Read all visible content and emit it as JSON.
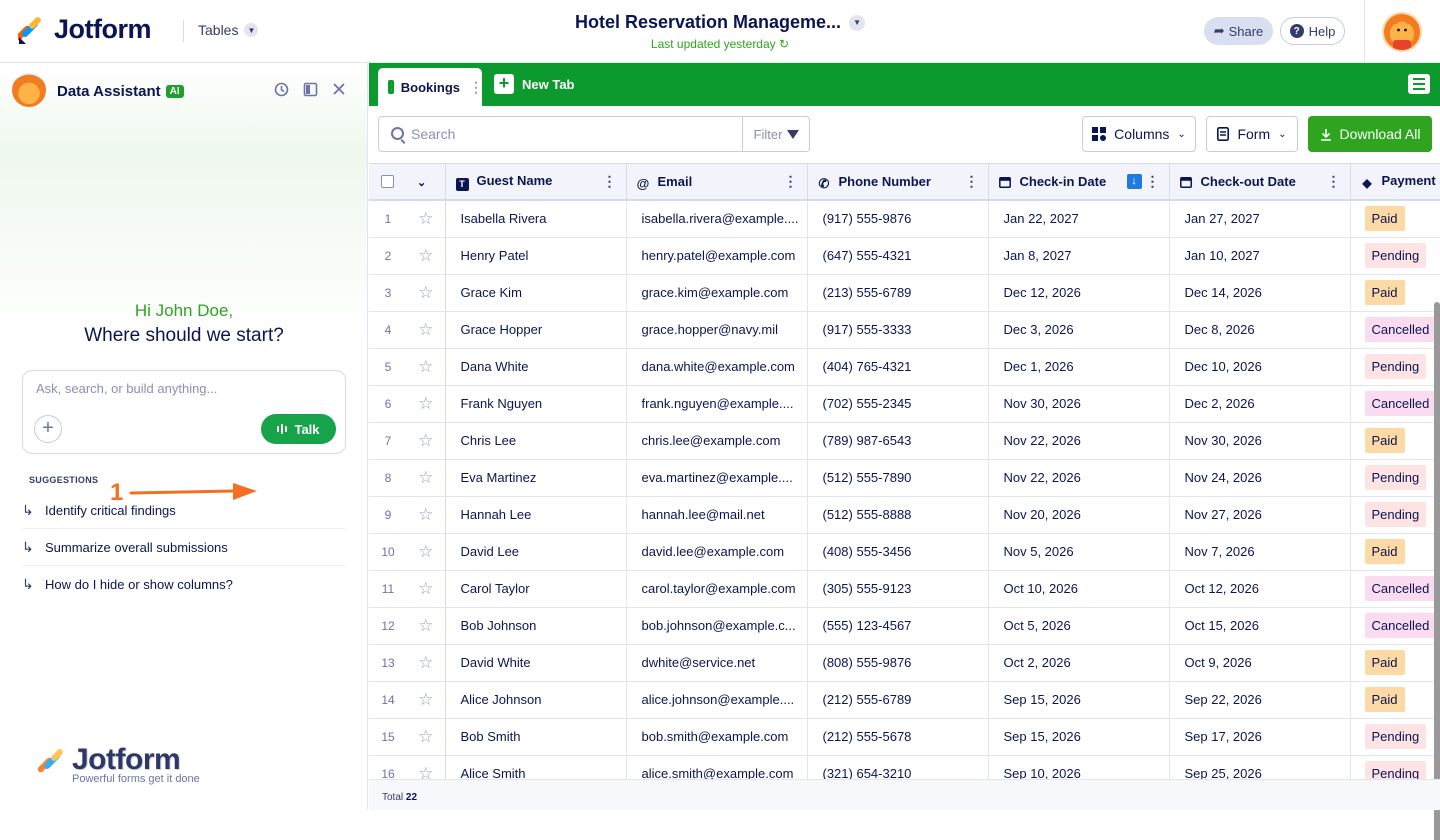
{
  "app": {
    "logo_text": "Jotform",
    "tables_label": "Tables",
    "title": "Hotel Reservation Manageme...",
    "updated": "Last updated yesterday",
    "share_label": "Share",
    "help_label": "Help"
  },
  "assistant": {
    "title": "Data Assistant",
    "ai_badge": "AI",
    "greeting": "Hi John Doe,",
    "prompt": "Where should we start?",
    "input_placeholder": "Ask, search, or build anything...",
    "talk_label": "Talk",
    "step_number": "1",
    "suggestions_title": "SUGGESTIONS",
    "suggestions": [
      "Identify critical findings",
      "Summarize overall submissions",
      "How do I hide or show columns?"
    ],
    "footer_logo": "Jotform",
    "footer_tagline": "Powerful forms get it done"
  },
  "tabs": {
    "active": "Bookings",
    "new_tab": "New Tab"
  },
  "toolbar": {
    "search_placeholder": "Search",
    "filter_label": "Filter",
    "columns_label": "Columns",
    "form_label": "Form",
    "download_label": "Download All"
  },
  "table": {
    "columns": [
      "Guest Name",
      "Email",
      "Phone Number",
      "Check-in Date",
      "Check-out Date",
      "Payment S"
    ],
    "rows": [
      [
        "1",
        "Isabella Rivera",
        "isabella.rivera@example....",
        "(917) 555-9876",
        "Jan 22, 2027",
        "Jan 27, 2027",
        "Paid"
      ],
      [
        "2",
        "Henry Patel",
        "henry.patel@example.com",
        "(647) 555-4321",
        "Jan 8, 2027",
        "Jan 10, 2027",
        "Pending"
      ],
      [
        "3",
        "Grace Kim",
        "grace.kim@example.com",
        "(213) 555-6789",
        "Dec 12, 2026",
        "Dec 14, 2026",
        "Paid"
      ],
      [
        "4",
        "Grace Hopper",
        "grace.hopper@navy.mil",
        "(917) 555-3333",
        "Dec 3, 2026",
        "Dec 8, 2026",
        "Cancelled"
      ],
      [
        "5",
        "Dana White",
        "dana.white@example.com",
        "(404) 765-4321",
        "Dec 1, 2026",
        "Dec 10, 2026",
        "Pending"
      ],
      [
        "6",
        "Frank Nguyen",
        "frank.nguyen@example....",
        "(702) 555-2345",
        "Nov 30, 2026",
        "Dec 2, 2026",
        "Cancelled"
      ],
      [
        "7",
        "Chris Lee",
        "chris.lee@example.com",
        "(789) 987-6543",
        "Nov 22, 2026",
        "Nov 30, 2026",
        "Paid"
      ],
      [
        "8",
        "Eva Martinez",
        "eva.martinez@example....",
        "(512) 555-7890",
        "Nov 22, 2026",
        "Nov 24, 2026",
        "Pending"
      ],
      [
        "9",
        "Hannah Lee",
        "hannah.lee@mail.net",
        "(512) 555-8888",
        "Nov 20, 2026",
        "Nov 27, 2026",
        "Pending"
      ],
      [
        "10",
        "David Lee",
        "david.lee@example.com",
        "(408) 555-3456",
        "Nov 5, 2026",
        "Nov 7, 2026",
        "Paid"
      ],
      [
        "11",
        "Carol Taylor",
        "carol.taylor@example.com",
        "(305) 555-9123",
        "Oct 10, 2026",
        "Oct 12, 2026",
        "Cancelled"
      ],
      [
        "12",
        "Bob Johnson",
        "bob.johnson@example.c...",
        "(555) 123-4567",
        "Oct 5, 2026",
        "Oct 15, 2026",
        "Cancelled"
      ],
      [
        "13",
        "David White",
        "dwhite@service.net",
        "(808) 555-9876",
        "Oct 2, 2026",
        "Oct 9, 2026",
        "Paid"
      ],
      [
        "14",
        "Alice Johnson",
        "alice.johnson@example....",
        "(212) 555-6789",
        "Sep 15, 2026",
        "Sep 22, 2026",
        "Paid"
      ],
      [
        "15",
        "Bob Smith",
        "bob.smith@example.com",
        "(212) 555-5678",
        "Sep 15, 2026",
        "Sep 17, 2026",
        "Pending"
      ],
      [
        "16",
        "Alice Smith",
        "alice.smith@example.com",
        "(321) 654-3210",
        "Sep 10, 2026",
        "Sep 25, 2026",
        "Pending"
      ]
    ],
    "status_colors": {
      "Paid": {
        "bg": "#fdd9a6",
        "fg": "#0a1551"
      },
      "Pending": {
        "bg": "#fde3e3",
        "fg": "#0a1551"
      },
      "Cancelled": {
        "bg": "#fbdbf0",
        "fg": "#0a1551"
      }
    },
    "total_label": "Total",
    "total_value": "22"
  },
  "colors": {
    "brand_green": "#0c9a2e",
    "accent_orange": "#f37021",
    "navy": "#0a1551"
  }
}
